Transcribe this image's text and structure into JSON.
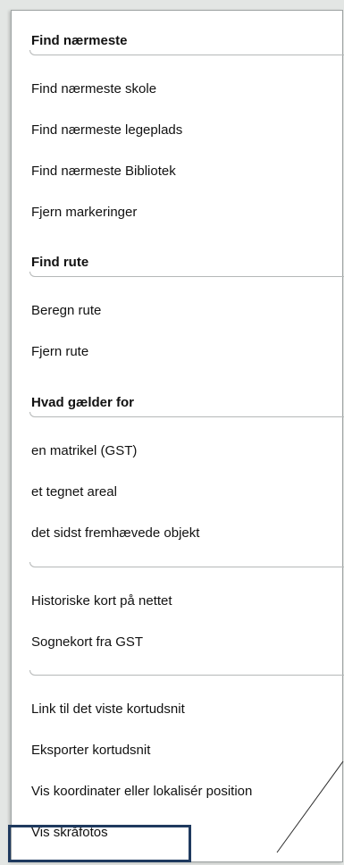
{
  "menu": {
    "find_nearest": {
      "header": "Find nærmeste",
      "items": [
        "Find nærmeste skole",
        "Find nærmeste legeplads",
        "Find nærmeste Bibliotek",
        "Fjern markeringer"
      ]
    },
    "find_route": {
      "header": "Find rute",
      "items": [
        "Beregn rute",
        "Fjern rute"
      ]
    },
    "applies_for": {
      "header": "Hvad gælder for",
      "items": [
        "en matrikel (GST)",
        "et tegnet areal",
        "det sidst fremhævede objekt"
      ]
    },
    "maps": {
      "items": [
        "Historiske kort på nettet",
        "Sognekort fra GST"
      ]
    },
    "tools": {
      "items": [
        "Link til det viste kortudsnit",
        "Eksporter kortudsnit",
        "Vis koordinater eller lokalisér position",
        "Vis skråfotos"
      ]
    }
  },
  "colors": {
    "highlight_border": "#1f3a5f",
    "separator": "#b5b8b8"
  }
}
